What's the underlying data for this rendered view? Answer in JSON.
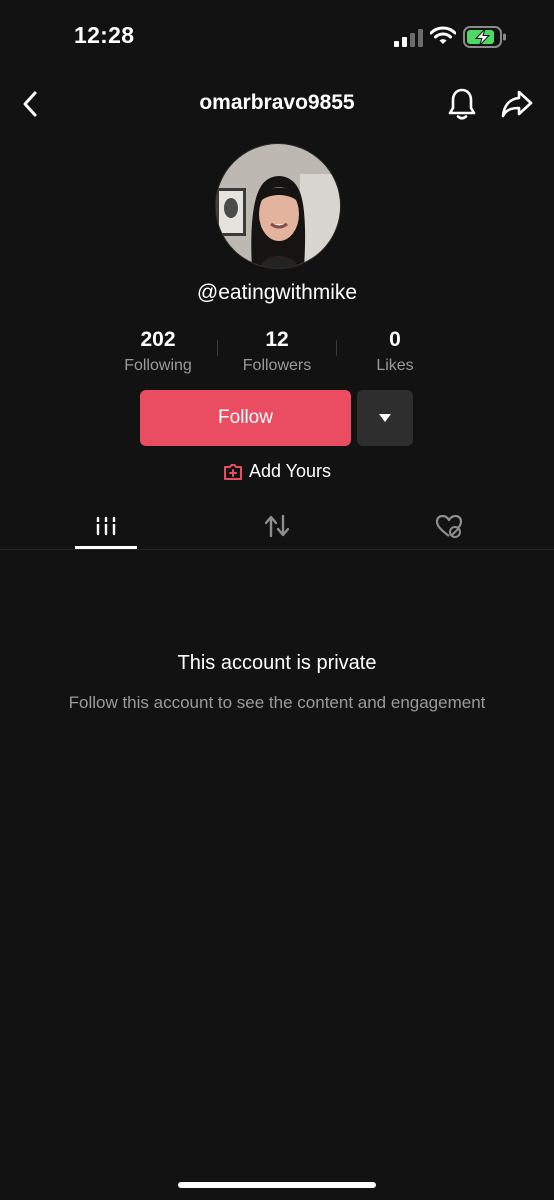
{
  "status_bar": {
    "time": "12:28"
  },
  "header": {
    "title": "omarbravo9855"
  },
  "profile": {
    "handle": "@eatingwithmike",
    "stats": [
      {
        "value": "202",
        "label": "Following"
      },
      {
        "value": "12",
        "label": "Followers"
      },
      {
        "value": "0",
        "label": "Likes"
      }
    ]
  },
  "actions": {
    "follow_label": "Follow",
    "add_yours_label": "Add Yours"
  },
  "tabs": [
    {
      "icon": "videos-grid-icon",
      "active": true
    },
    {
      "icon": "repost-icon",
      "active": false
    },
    {
      "icon": "liked-hidden-icon",
      "active": false
    }
  ],
  "private_notice": {
    "title": "This account is private",
    "subtitle": "Follow this account to see the content and engagement"
  },
  "colors": {
    "background": "#121212",
    "follow_button": "#ea4c62",
    "secondary_button": "#2e2e2e",
    "muted_text": "#9a9a9a",
    "battery_charge": "#4cd964"
  }
}
